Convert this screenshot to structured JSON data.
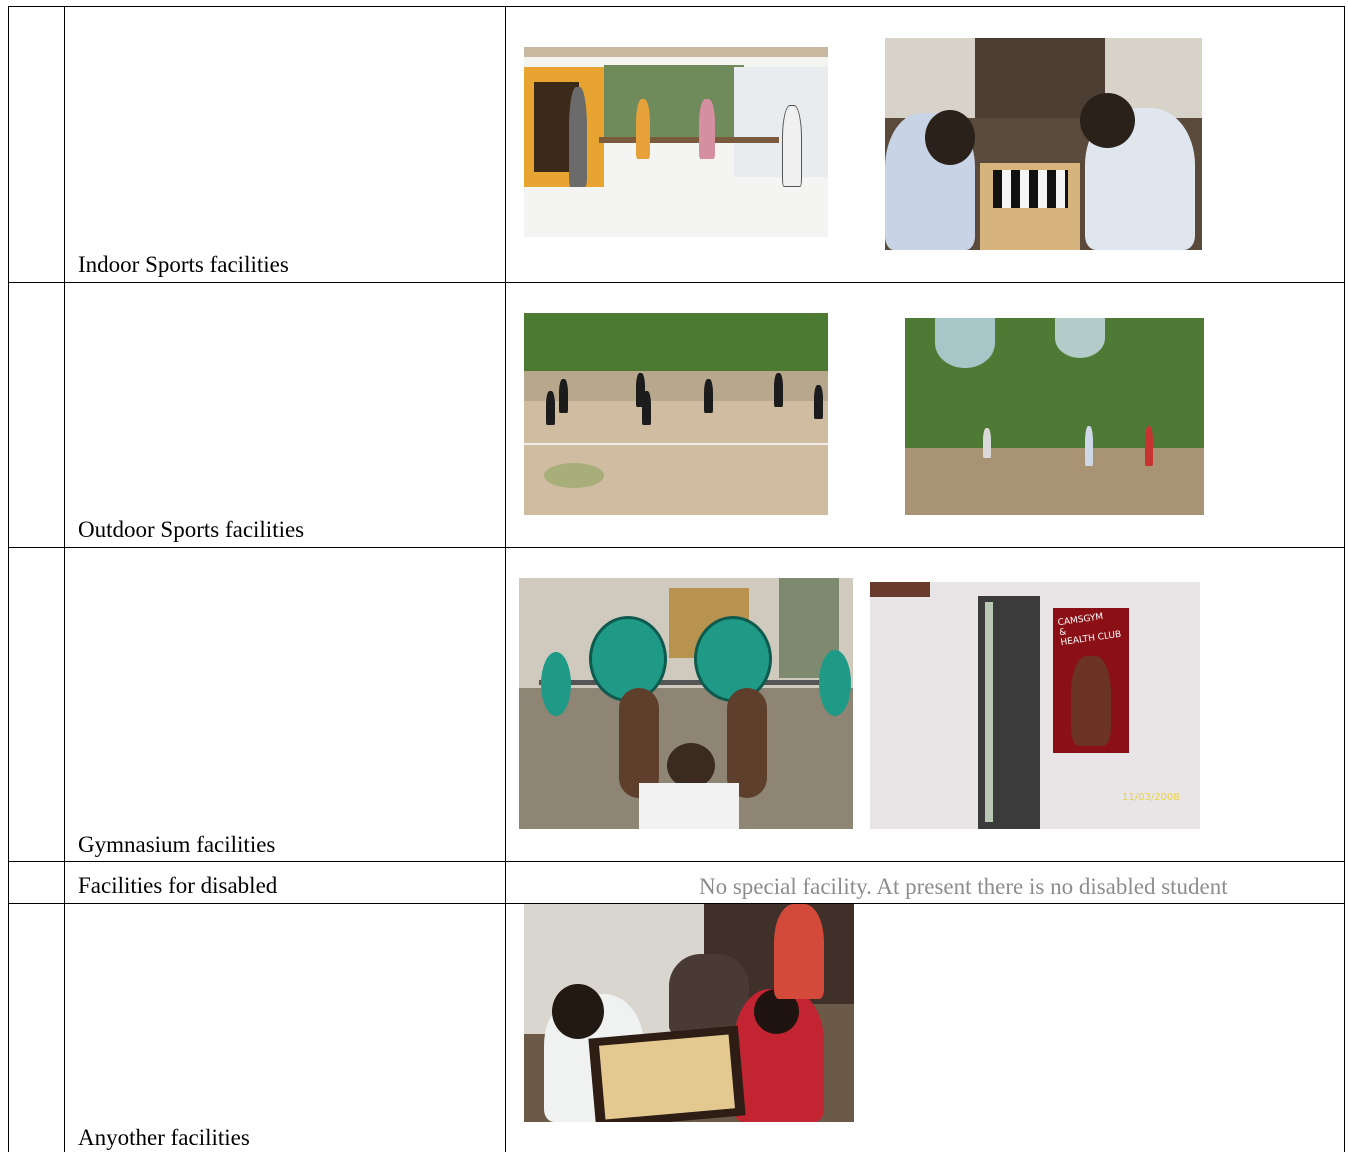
{
  "rows": [
    {
      "label": "Indoor Sports facilities",
      "images": [
        "table-tennis-photo",
        "chess-photo"
      ]
    },
    {
      "label": "Outdoor Sports facilities",
      "images": [
        "volleyball-ground-photo",
        "cricket-ground-photo"
      ]
    },
    {
      "label": "Gymnasium facilities",
      "images": [
        "weightlifting-photo",
        "gym-entrance-photo"
      ]
    },
    {
      "label": "Facilities for disabled",
      "note": "No special facility.  At present  there is no disabled student"
    },
    {
      "label": "Anyother facilities",
      "images": [
        "carrom-photo"
      ]
    }
  ],
  "poster_text": {
    "line1": "CAMSGYM",
    "line2": "&",
    "line3": "HEALTH CLUB"
  },
  "photo_date": "11/03/2008"
}
